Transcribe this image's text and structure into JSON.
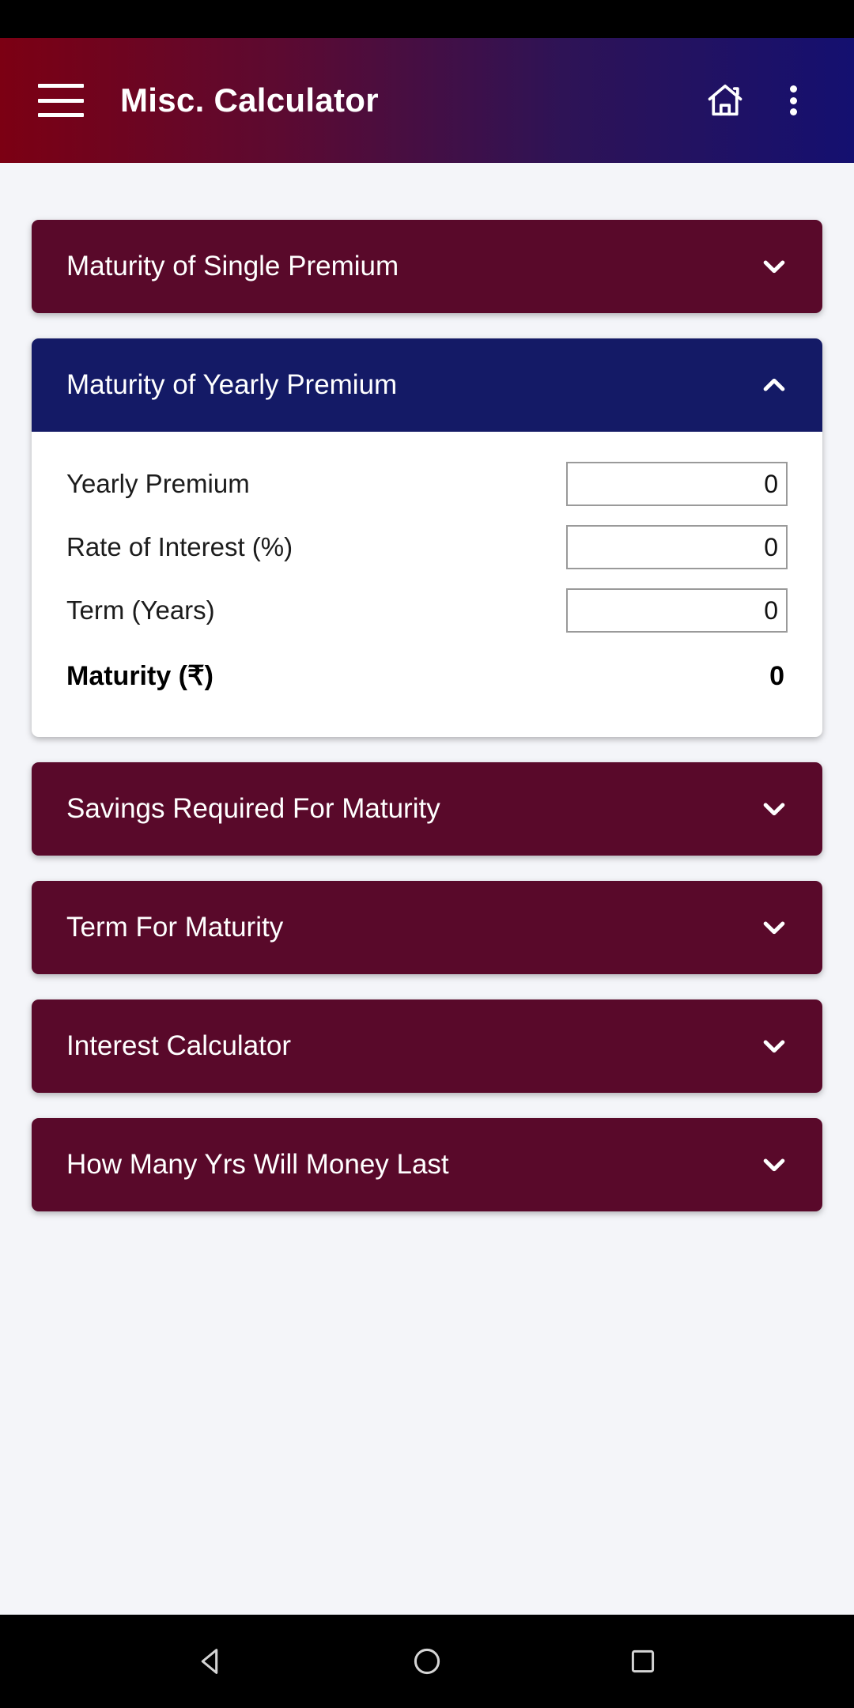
{
  "app_bar": {
    "title": "Misc. Calculator",
    "menu_icon": "hamburger-menu-icon",
    "home_icon": "home-icon",
    "overflow_icon": "more-vertical-icon",
    "gradient_start": "#7c0013",
    "gradient_end": "#141070"
  },
  "theme": {
    "collapsed_header_color": "#59092a",
    "expanded_header_color": "#141a66",
    "page_background": "#f4f5f9",
    "card_body_color": "#ffffff",
    "input_border_color": "#9a9a9a"
  },
  "sections": [
    {
      "label": "Maturity of Single Premium",
      "expanded": false,
      "chevron": "chevron-down-icon"
    },
    {
      "label": "Maturity of Yearly Premium",
      "expanded": true,
      "chevron": "chevron-up-icon",
      "fields": [
        {
          "label": "Yearly Premium",
          "value": "0"
        },
        {
          "label": "Rate of Interest (%)",
          "value": "0"
        },
        {
          "label": "Term (Years)",
          "value": "0"
        }
      ],
      "result": {
        "label": "Maturity (₹)",
        "value": "0"
      }
    },
    {
      "label": "Savings Required For Maturity",
      "expanded": false,
      "chevron": "chevron-down-icon"
    },
    {
      "label": "Term For Maturity",
      "expanded": false,
      "chevron": "chevron-down-icon"
    },
    {
      "label": "Interest Calculator",
      "expanded": false,
      "chevron": "chevron-down-icon"
    },
    {
      "label": "How Many Yrs Will Money Last",
      "expanded": false,
      "chevron": "chevron-down-icon"
    }
  ],
  "nav_bar": {
    "back": "back-triangle-icon",
    "home": "home-circle-icon",
    "recents": "recents-square-icon"
  }
}
